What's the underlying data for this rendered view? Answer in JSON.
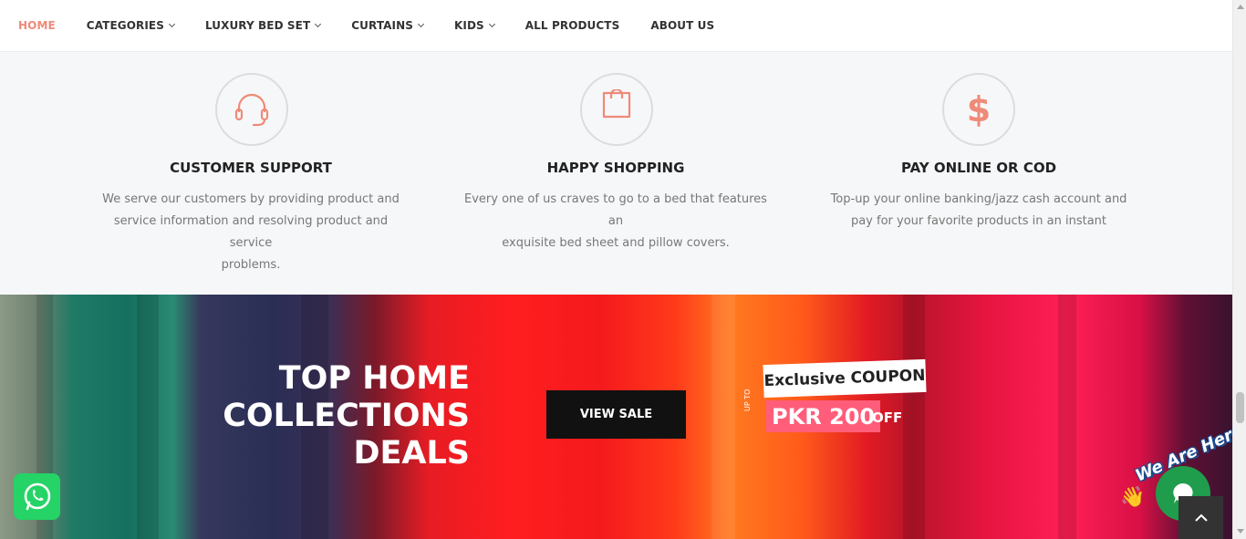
{
  "nav": {
    "items": [
      {
        "label": "HOME",
        "active": true,
        "dropdown": false
      },
      {
        "label": "CATEGORIES",
        "active": false,
        "dropdown": true
      },
      {
        "label": "LUXURY BED SET",
        "active": false,
        "dropdown": true
      },
      {
        "label": "CURTAINS",
        "active": false,
        "dropdown": true
      },
      {
        "label": "KIDS",
        "active": false,
        "dropdown": true
      },
      {
        "label": "ALL PRODUCTS",
        "active": false,
        "dropdown": false
      },
      {
        "label": "ABOUT US",
        "active": false,
        "dropdown": false
      }
    ],
    "active_color": "#ef8a78"
  },
  "features": [
    {
      "icon": "headset-icon",
      "title": "CUSTOMER SUPPORT",
      "desc_lines": [
        "We serve our customers by providing product and",
        "service information and resolving product and service",
        "problems."
      ]
    },
    {
      "icon": "shopping-bag-icon",
      "title": "HAPPY SHOPPING",
      "desc_lines": [
        "Every one of us craves to go to a bed that features an",
        "exquisite bed sheet and pillow covers."
      ]
    },
    {
      "icon": "dollar-icon",
      "title": "PAY ONLINE OR COD",
      "desc_lines": [
        "Top-up your online banking/jazz cash account and",
        "pay for your favorite products in an instant"
      ]
    }
  ],
  "banner": {
    "headline_lines": [
      "TOP HOME",
      "COLLECTIONS",
      "DEALS"
    ],
    "button_label": "VIEW SALE",
    "coupon_title": "Exclusive COUPON",
    "upto": "UP TO",
    "amount": "PKR 200",
    "off": "OFF"
  },
  "widgets": {
    "chat_badge": "We Are Here!",
    "whatsapp": "whatsapp-icon",
    "chat": "chat-bubble-icon",
    "scroll_top": "chevron-up-icon"
  },
  "colors": {
    "accent": "#ef8a78",
    "dark_button": "#111111",
    "coupon_pink": "#ff5d7a",
    "whatsapp_green": "#25d366"
  }
}
